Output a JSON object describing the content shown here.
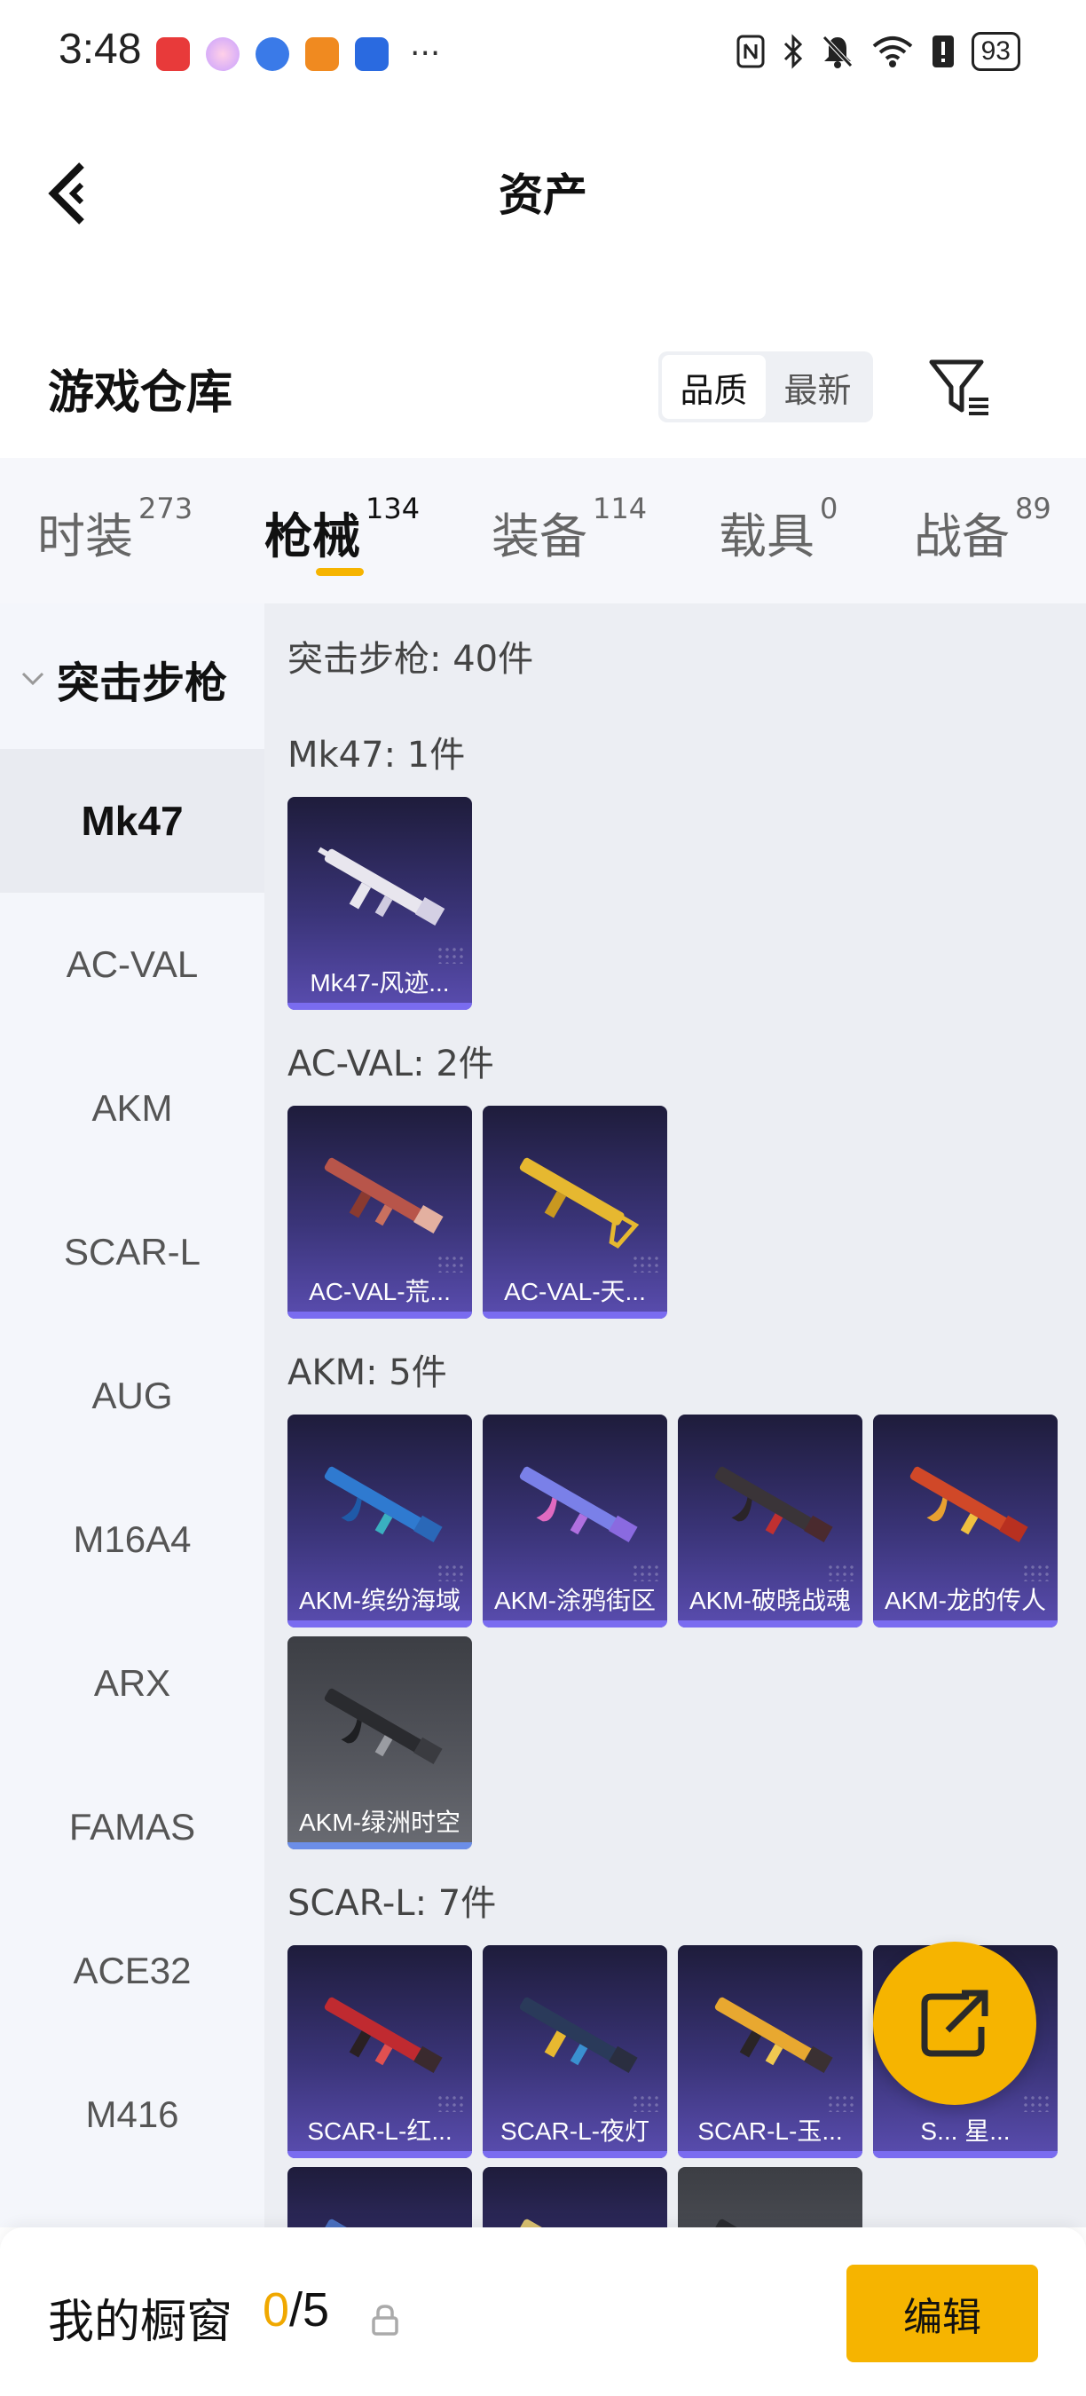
{
  "status_bar": {
    "time": "3:48",
    "more": "···",
    "icons": [
      "nfc-icon",
      "bluetooth-icon",
      "mute-icon",
      "wifi-icon",
      "alert-icon"
    ],
    "battery": "93"
  },
  "header": {
    "title": "资产"
  },
  "warehouse": {
    "title": "游戏仓库",
    "sort": {
      "quality": "品质",
      "latest": "最新",
      "selected": "品质"
    }
  },
  "tabs": [
    {
      "label": "时装",
      "count": "273"
    },
    {
      "label": "枪械",
      "count": "134"
    },
    {
      "label": "装备",
      "count": "114"
    },
    {
      "label": "载具",
      "count": "0"
    },
    {
      "label": "战备",
      "count": "89"
    }
  ],
  "active_tab": "枪械",
  "sidebar": {
    "group": "突击步枪",
    "items": [
      "Mk47",
      "AC-VAL",
      "AKM",
      "SCAR-L",
      "AUG",
      "M16A4",
      "ARX",
      "FAMAS",
      "ACE32",
      "M416"
    ],
    "selected": "Mk47"
  },
  "content": {
    "summary": "突击步枪: 40件",
    "sections": [
      {
        "title": "Mk47: 1件",
        "items": [
          "Mk47-风迹..."
        ]
      },
      {
        "title": "AC-VAL: 2件",
        "items": [
          "AC-VAL-荒...",
          "AC-VAL-天..."
        ]
      },
      {
        "title": "AKM: 5件",
        "items": [
          "AKM-缤纷海域",
          "AKM-涂鸦街区",
          "AKM-破晓战魂",
          "AKM-龙的传人",
          "AKM-绿洲时空"
        ]
      },
      {
        "title": "SCAR-L: 7件",
        "items": [
          "SCAR-L-红...",
          "SCAR-L-夜灯",
          "SCAR-L-玉...",
          "S... 星..."
        ]
      }
    ]
  },
  "showcase": {
    "title": "我的橱窗",
    "current": "0",
    "total": "/5",
    "edit_label": "编辑"
  },
  "colors": {
    "accent": "#f6b400",
    "card_purple": "#3a3478",
    "card_gray": "#55575e"
  }
}
